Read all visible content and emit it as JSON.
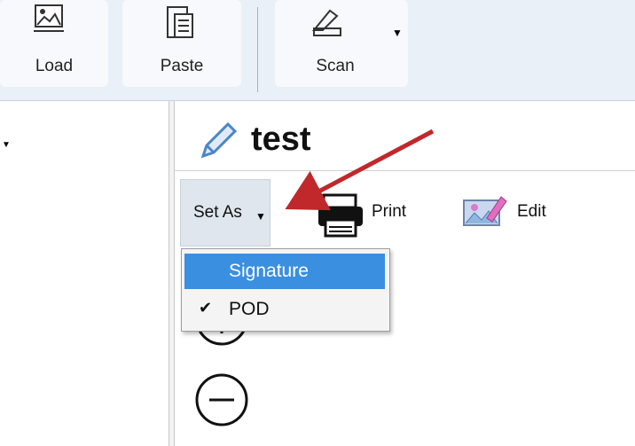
{
  "ribbon": {
    "load_label": "Load",
    "paste_label": "Paste",
    "scan_label": "Scan"
  },
  "document": {
    "title": "test"
  },
  "toolbar": {
    "set_as_label": "Set As",
    "print_label": "Print",
    "edit_label": "Edit"
  },
  "set_as_menu": {
    "items": [
      {
        "label": "Signature",
        "highlighted": true,
        "checked": false
      },
      {
        "label": "POD",
        "highlighted": false,
        "checked": true
      }
    ]
  },
  "colors": {
    "menu_highlight": "#3a8fe0",
    "annotation_arrow": "#c0282b",
    "ribbon_bg": "#e9f0f8"
  }
}
